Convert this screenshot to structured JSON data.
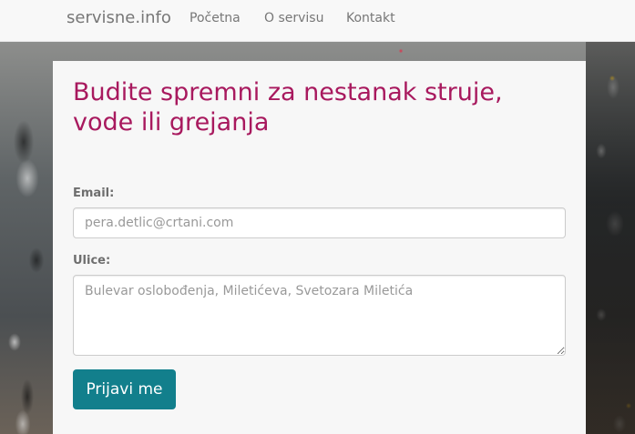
{
  "navbar": {
    "brand": "servisne.info",
    "links": [
      {
        "label": "Početna"
      },
      {
        "label": "O servisu"
      },
      {
        "label": "Kontakt"
      }
    ]
  },
  "form": {
    "title_line1": "Budite spremni za nestanak struje,",
    "title_line2": "vode ili grejanja",
    "email_label": "Email:",
    "email_placeholder": "pera.detlic@crtani.com",
    "email_value": "",
    "streets_label": "Ulice:",
    "streets_placeholder": "Bulevar oslobođenja, Miletićeva, Svetozara Miletića",
    "streets_value": "",
    "submit_label": "Prijavi me"
  },
  "colors": {
    "title": "#a8195e",
    "button": "#127f8c",
    "navbar_bg": "#f8f8f8"
  }
}
